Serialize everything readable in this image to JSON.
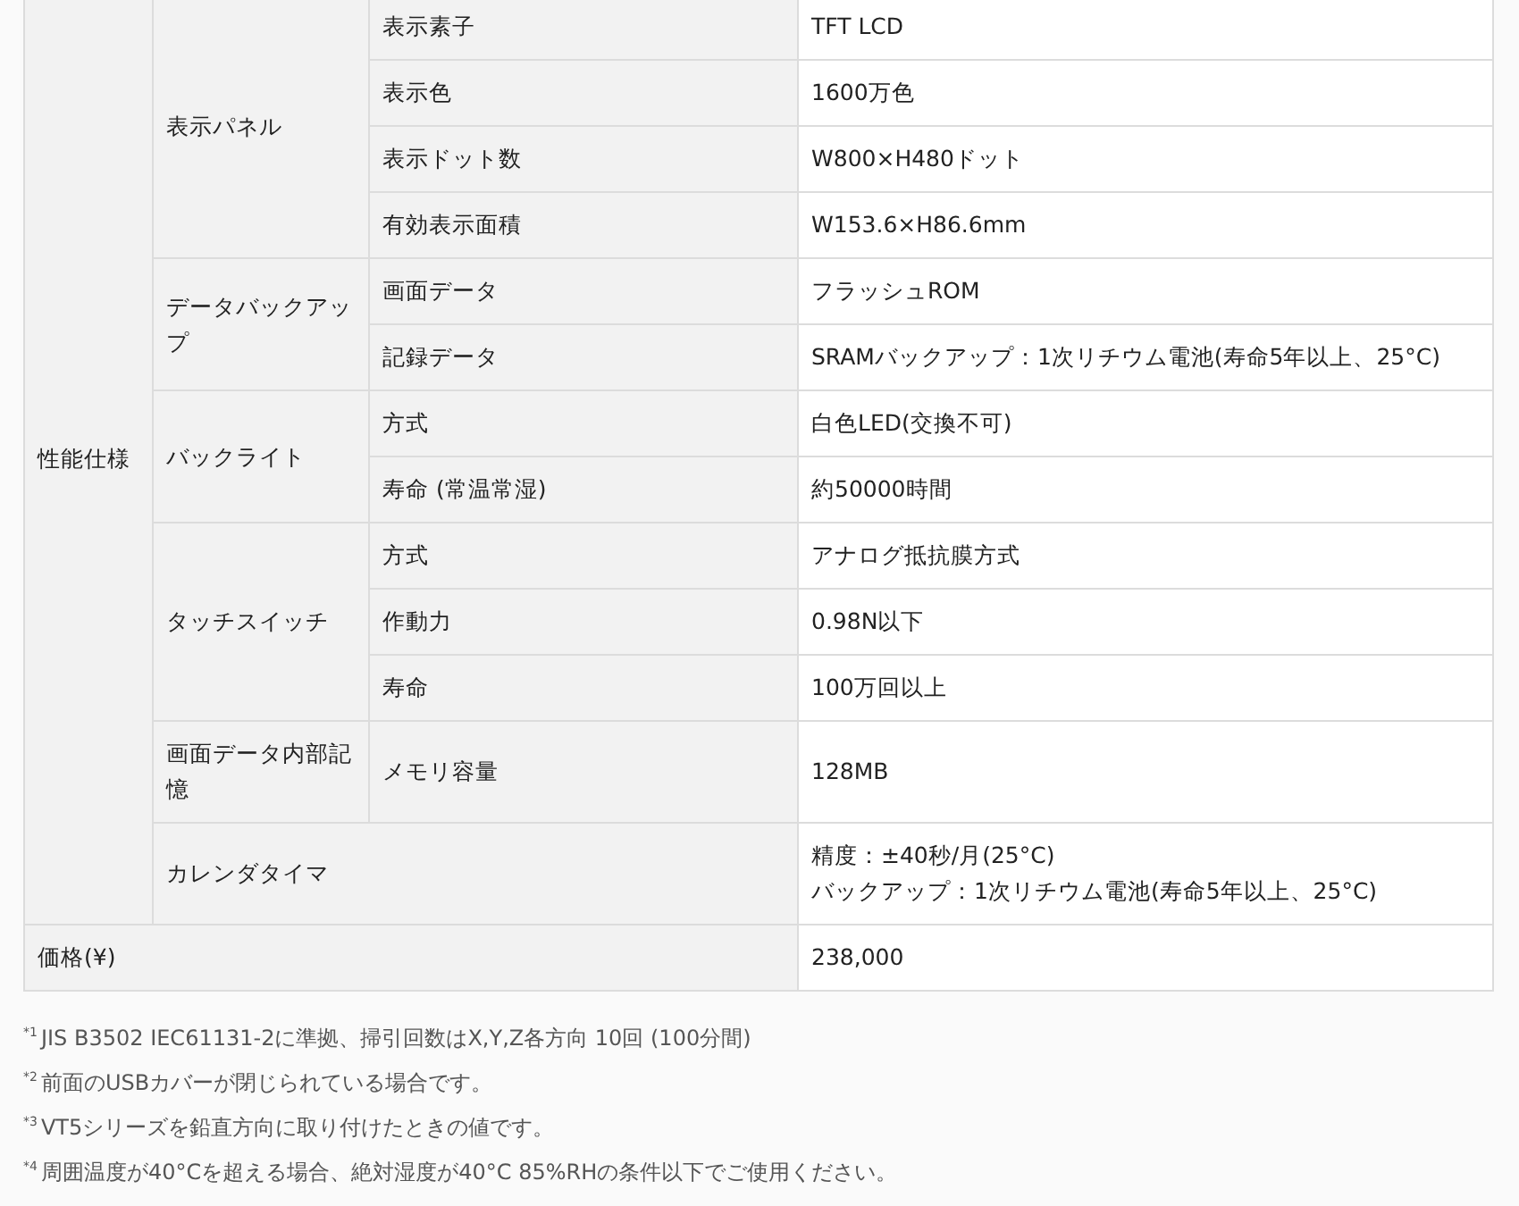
{
  "spec_table": {
    "sections": [
      {
        "label": "性能仕様",
        "groups": [
          {
            "label": "表示パネル",
            "items": [
              {
                "label": "表示素子",
                "value": "TFT LCD"
              },
              {
                "label": "表示色",
                "value": "1600万色"
              },
              {
                "label": "表示ドット数",
                "value": "W800×H480ドット"
              },
              {
                "label": "有効表示面積",
                "value": "W153.6×H86.6mm"
              }
            ]
          },
          {
            "label": "データバックアップ",
            "items": [
              {
                "label": "画面データ",
                "value": "フラッシュROM"
              },
              {
                "label": "記録データ",
                "value": "SRAMバックアップ：1次リチウム電池(寿命5年以上、25°C)"
              }
            ]
          },
          {
            "label": "バックライト",
            "items": [
              {
                "label": "方式",
                "value": "白色LED(交換不可)"
              },
              {
                "label": "寿命 (常温常湿)",
                "value": "約50000時間"
              }
            ]
          },
          {
            "label": "タッチスイッチ",
            "items": [
              {
                "label": "方式",
                "value": "アナログ抵抗膜方式"
              },
              {
                "label": "作動力",
                "value": "0.98N以下"
              },
              {
                "label": "寿命",
                "value": "100万回以上"
              }
            ]
          },
          {
            "label": "画面データ内部記憶",
            "items": [
              {
                "label": "メモリ容量",
                "value": "128MB"
              }
            ]
          },
          {
            "label": "カレンダタイマ",
            "value": [
              "精度：±40秒/月(25°C)",
              "バックアップ：1次リチウム電池(寿命5年以上、25°C)"
            ]
          }
        ]
      }
    ],
    "price": {
      "label": "価格(¥)",
      "value": "238,000"
    }
  },
  "footnotes": [
    {
      "mark": "*1",
      "text": "JIS B3502 IEC61131-2に準拠、掃引回数はX,Y,Z各方向 10回 (100分間)"
    },
    {
      "mark": "*2",
      "text": "前面のUSBカバーが閉じられている場合です。"
    },
    {
      "mark": "*3",
      "text": "VT5シリーズを鉛直方向に取り付けたときの値です。"
    },
    {
      "mark": "*4",
      "text": "周囲温度が40°Cを超える場合、絶対湿度が40°C 85%RHの条件以下でご使用ください。"
    }
  ]
}
